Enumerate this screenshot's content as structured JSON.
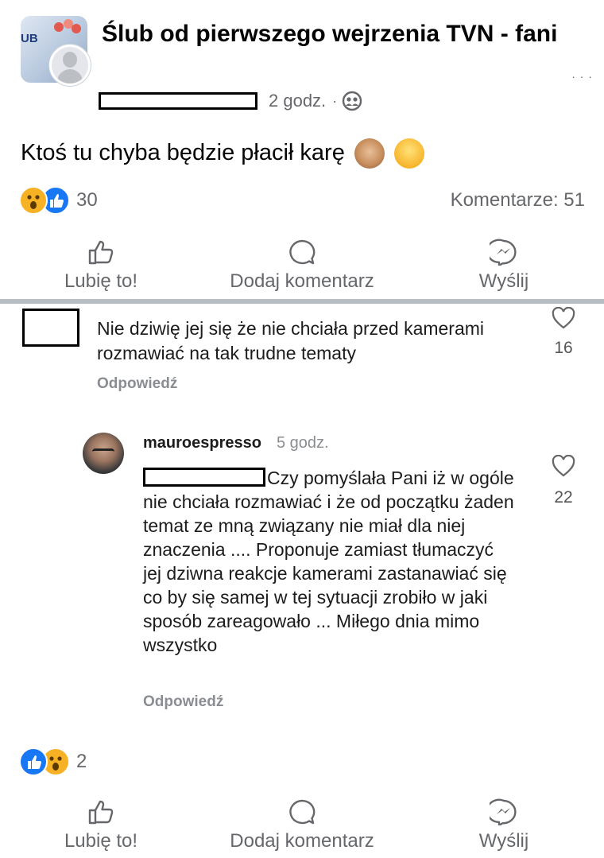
{
  "post": {
    "group_name": "Ślub od pierwszego wejrzenia TVN - fani",
    "group_avatar_text": "UB",
    "time": "2 godz.",
    "separator": "·",
    "privacy_icon": "group-members-icon",
    "text": "Ktoś tu chyba będzie płacił karę",
    "text_emojis": [
      "see-no-evil-monkey-emoji",
      "grinning-sweat-emoji"
    ],
    "reactions": {
      "icons": [
        "wow",
        "like"
      ],
      "count": "30"
    },
    "comments_label": "Komentarze: 51"
  },
  "actions_top": {
    "like": "Lubię to!",
    "comment": "Dodaj komentarz",
    "send": "Wyślij"
  },
  "comments": [
    {
      "text": "Nie dziwię jej się że nie chciała przed kamerami rozmawiać na tak trudne tematy",
      "reply": "Odpowiedź",
      "likes": "16"
    },
    {
      "author": "mauroespresso",
      "time": "5 godz.",
      "text": "Czy pomyślała Pani iż w ogóle nie chciała rozmawiać i że od początku żaden temat ze mną związany nie miał dla niej znaczenia .... Proponuje zamiast tłumaczyć jej dziwna reakcje kamerami zastanawiać się co by się samej w tej sytuacji zrobiło w jaki sposób zareagowało ... Miłego dnia mimo wszystko",
      "reply": "Odpowiedź",
      "likes": "22"
    }
  ],
  "bottom": {
    "reactions": {
      "icons": [
        "like",
        "wow"
      ],
      "count": "2"
    },
    "like": "Lubię to!",
    "comment": "Dodaj komentarz",
    "send": "Wyślij"
  },
  "colors": {
    "like_blue": "#1877f2",
    "wow_yellow": "#f7b125",
    "secondary_text": "#65676b"
  }
}
